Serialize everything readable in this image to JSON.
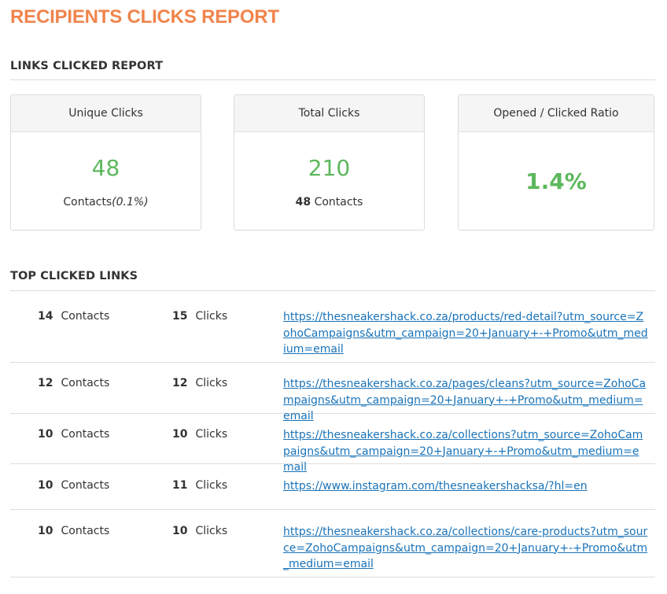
{
  "colors": {
    "title": "#f0844c",
    "metric": "#5cb85c",
    "link": "#1a73b8"
  },
  "page_title": "RECIPIENTS CLICKS REPORT",
  "links_clicked": {
    "heading": "LINKS CLICKED REPORT",
    "cards": [
      {
        "label": "Unique Clicks",
        "value": "48",
        "sub_prefix": "Contacts",
        "sub_italic": "(0.1%)"
      },
      {
        "label": "Total Clicks",
        "value": "210",
        "sub_bold": "48",
        "sub_suffix": " Contacts"
      },
      {
        "label": "Opened / Clicked Ratio",
        "value": "1.4%"
      }
    ]
  },
  "top_links": {
    "heading": "TOP CLICKED LINKS",
    "contacts_label": "Contacts",
    "clicks_label": "Clicks",
    "rows": [
      {
        "contacts": "14",
        "clicks": "15",
        "url": "https://thesneakershack.co.za/products/red-detail?utm_source=ZohoCampaigns&utm_campaign=20+January+-+Promo&utm_medium=email"
      },
      {
        "contacts": "12",
        "clicks": "12",
        "url": "https://thesneakershack.co.za/pages/cleans?utm_source=ZohoCampaigns&utm_campaign=20+January+-+Promo&utm_medium=email"
      },
      {
        "contacts": "10",
        "clicks": "10",
        "url": "https://thesneakershack.co.za/collections?utm_source=ZohoCampaigns&utm_campaign=20+January+-+Promo&utm_medium=email"
      },
      {
        "contacts": "10",
        "clicks": "11",
        "url": "https://www.instagram.com/thesneakershacksa/?hl=en"
      },
      {
        "contacts": "10",
        "clicks": "10",
        "url": "https://thesneakershack.co.za/collections/care-products?utm_source=ZohoCampaigns&utm_campaign=20+January+-+Promo&utm_medium=email"
      }
    ]
  }
}
